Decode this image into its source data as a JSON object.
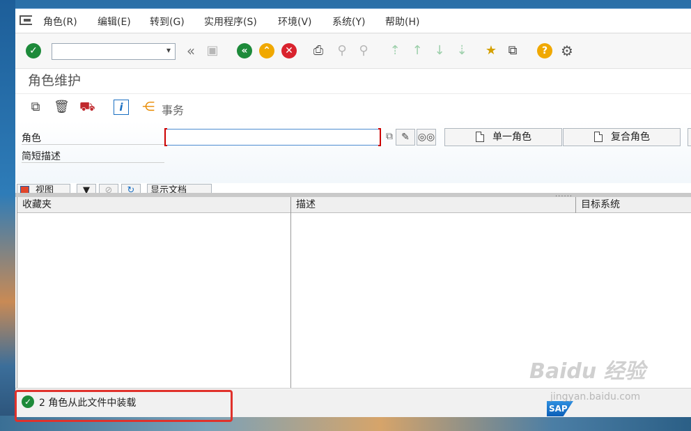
{
  "menubar": {
    "items": [
      "角色(R)",
      "编辑(E)",
      "转到(G)",
      "实用程序(S)",
      "环境(V)",
      "系统(Y)",
      "帮助(H)"
    ]
  },
  "toolbar": {
    "command_value": "",
    "icons": [
      "enter-icon",
      "back-icon",
      "save-icon",
      "back-green-icon",
      "exit-icon",
      "cancel-icon",
      "print-icon",
      "find-icon",
      "find-next-icon",
      "first-page-icon",
      "prev-page-icon",
      "next-page-icon",
      "last-page-icon",
      "new-session-icon",
      "shortcut-icon",
      "help-icon",
      "settings-icon"
    ]
  },
  "page": {
    "title": "角色维护"
  },
  "app_toolbar": {
    "transactions_label": "事务"
  },
  "form": {
    "role_label": "角色",
    "short_desc_label": "简短描述",
    "role_value": "",
    "single_role_button": "单一角色",
    "composite_role_button": "复合角色"
  },
  "tree_toolbar": {
    "view_label": "视图",
    "display_doc_label": "显示文档"
  },
  "grid": {
    "columns": [
      "收藏夹",
      "描述",
      "目标系统"
    ],
    "rows": []
  },
  "status": {
    "message": "2 角色从此文件中装载",
    "type": "success"
  },
  "colors": {
    "success_green": "#1d8a3a",
    "error_red": "#d9232e",
    "warning_orange": "#f0a800",
    "highlight_red": "#e0312b"
  }
}
